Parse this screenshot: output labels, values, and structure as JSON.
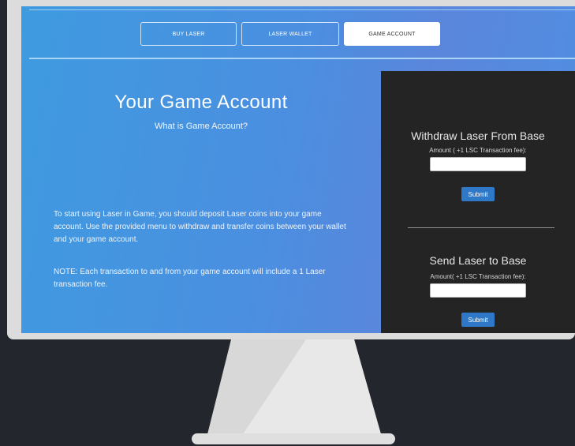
{
  "nav": {
    "tabs": [
      {
        "label": "BUY LASER",
        "active": false
      },
      {
        "label": "LASER WALLET",
        "active": false
      },
      {
        "label": "GAME ACCOUNT",
        "active": true
      }
    ]
  },
  "main": {
    "title": "Your Game Account",
    "subtitle": "What is Game Account?",
    "paragraph1": "To start using Laser in Game, you should deposit Laser coins into your game account. Use the provided menu to withdraw and transfer coins between your wallet and your game account.",
    "paragraph2": "NOTE: Each transaction to and from your game account will include a 1 Laser transaction fee."
  },
  "panel": {
    "withdraw": {
      "title": "Withdraw Laser From Base",
      "label": "Amount ( +1 LSC Transaction fee):",
      "value": "",
      "submit": "Submit"
    },
    "send": {
      "title": "Send Laser to Base",
      "label": "Amount( +1 LSC Transaction fee):",
      "value": "",
      "submit": "Submit"
    }
  },
  "colors": {
    "panel_bg": "#242424",
    "submit_bg": "#2f78c7",
    "gradient_start": "#3f9be0",
    "gradient_end": "#5a86dc"
  }
}
